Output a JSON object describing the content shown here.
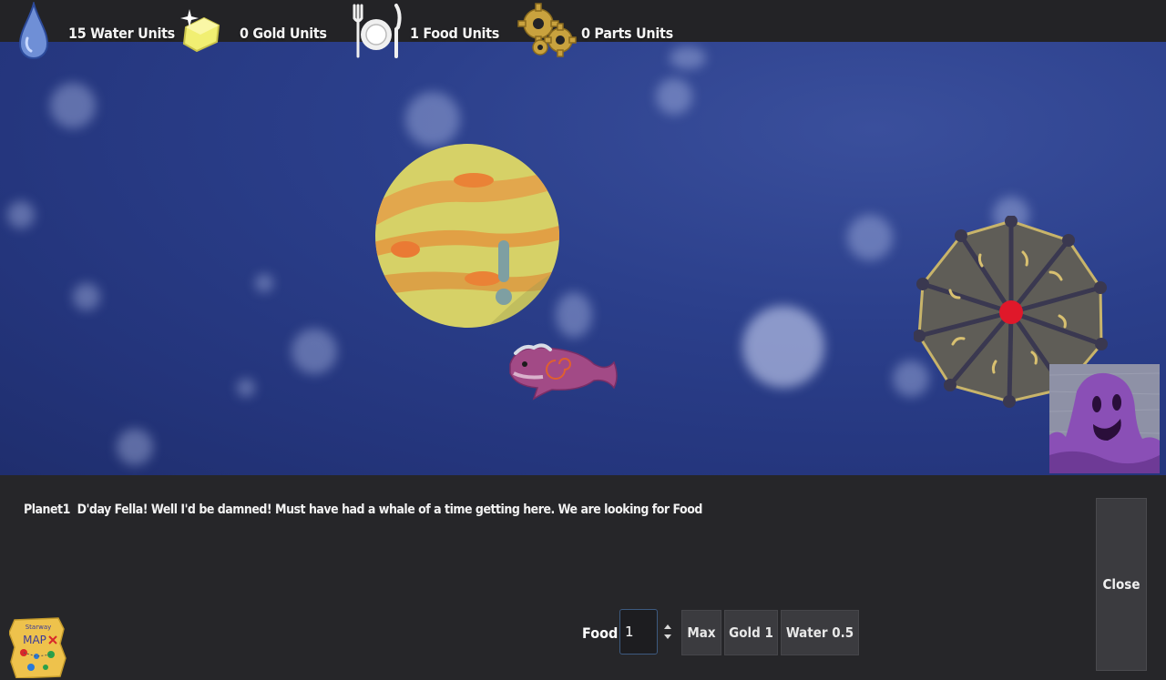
{
  "resources": [
    {
      "icon": "water-drop-icon",
      "label": "15 Water Units"
    },
    {
      "icon": "gold-bar-icon",
      "label": "0 Gold Units"
    },
    {
      "icon": "plate-cutlery-icon",
      "label": "1 Food Units"
    },
    {
      "icon": "gears-icon",
      "label": "0 Parts Units"
    }
  ],
  "dialog": {
    "speaker": "Planet1",
    "message": "D'day Fella! Well I'd be damned! Must have had a whale of a time getting here. We are looking for Food"
  },
  "trade": {
    "item_label": "Food",
    "quantity": "1",
    "max_label": "Max",
    "gold_label": "Gold 1",
    "water_label": "Water 0.5"
  },
  "close_label": "Close",
  "map_icon": {
    "title_small": "Starway",
    "title_big": "MAP"
  },
  "colors": {
    "space": "#2b3f8b",
    "panel": "#262629",
    "button": "#3b3b3f",
    "planet_yellow": "#d9d36a",
    "planet_orange": "#e28c3c",
    "station_grey": "#5c5a55",
    "station_core": "#e0182a",
    "whale": "#a24a86",
    "alien": "#8a4fb6"
  }
}
